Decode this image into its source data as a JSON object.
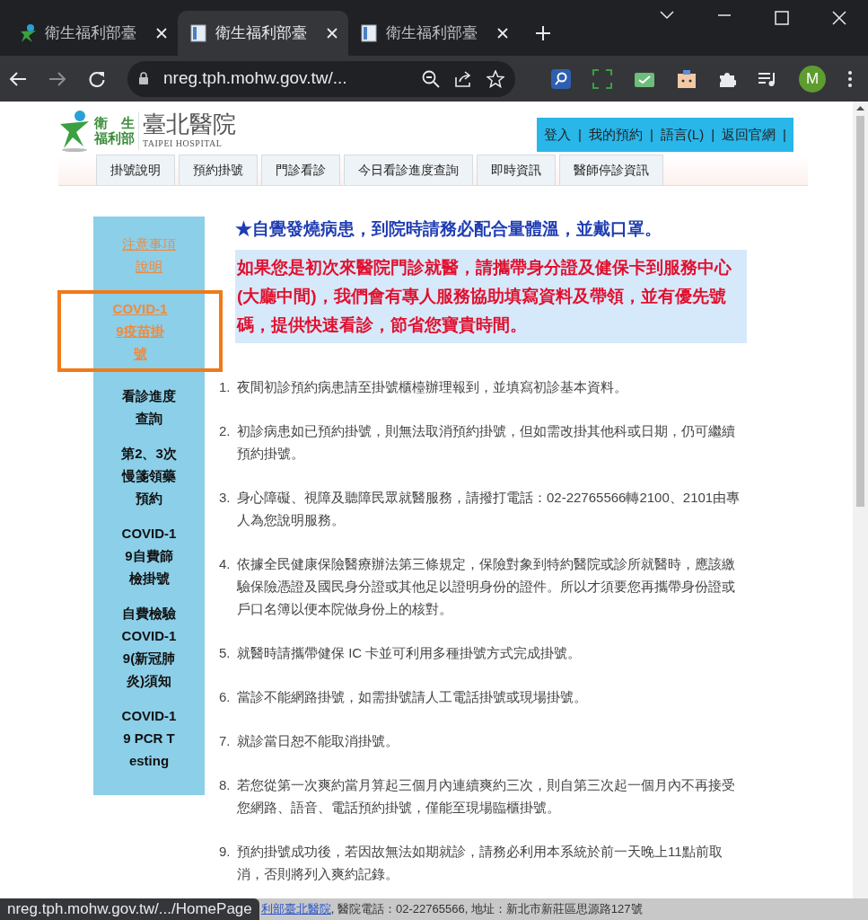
{
  "browser": {
    "tabs": [
      {
        "title": "衛生福利部臺",
        "selected": false,
        "kind": "logo"
      },
      {
        "title": "衛生福利部臺",
        "selected": true,
        "kind": "doc"
      },
      {
        "title": "衛生福利部臺",
        "selected": false,
        "kind": "doc"
      }
    ],
    "address": "nreg.tph.mohw.gov.tw/...",
    "profile": "M"
  },
  "header": {
    "logo": {
      "org_lines": [
        "衛　生",
        "福利部"
      ],
      "title": "臺北醫院",
      "subtitle": "TAIPEI HOSPITAL"
    },
    "top_links": [
      "登入",
      "我的預約",
      "語言(L)",
      "返回官網"
    ],
    "separator": "|",
    "nav_tabs": [
      "掛號說明",
      "預約掛號",
      "門診看診",
      "今日看診進度查詢",
      "即時資訊",
      "醫師停診資訊"
    ]
  },
  "sidebar": [
    {
      "text": "注意事項說明",
      "kind": "link",
      "highlighted": false
    },
    {
      "text": "COVID-19疫苗掛號",
      "kind": "link-bold",
      "highlighted": true
    },
    {
      "text": "看診進度查詢",
      "kind": "bold",
      "highlighted": false
    },
    {
      "text": "第2、3次慢箋領藥預約",
      "kind": "bold",
      "highlighted": false
    },
    {
      "text": "COVID-19自費篩檢掛號",
      "kind": "bold",
      "highlighted": false
    },
    {
      "text": "自費檢驗COVID-19(新冠肺炎)須知",
      "kind": "bold",
      "highlighted": false
    },
    {
      "text": "COVID-19 PCR Testing",
      "kind": "bold",
      "highlighted": false
    }
  ],
  "notice": {
    "headline": "★自覺發燒病患，到院時請務必配合量體溫，並戴口罩。",
    "box": "如果您是初次來醫院門診就醫，請攜帶身分證及健保卡到服務中心(大廳中間)，我們會有專人服務協助填寫資料及帶領，並有優先號碼，提供快速看診，節省您寶貴時間。"
  },
  "rules": [
    {
      "number": "1.",
      "text": "夜間初診預約病患請至掛號櫃檯辦理報到，並填寫初診基本資料。"
    },
    {
      "number": "2.",
      "text": "初診病患如已預約掛號，則無法取消預約掛號，但如需改掛其他科或日期，仍可繼續預約掛號。"
    },
    {
      "number": "3.",
      "text": "身心障礙、視障及聽障民眾就醫服務，請撥打電話：02-22765566轉2100、2101由專人為您說明服務。"
    },
    {
      "number": "4.",
      "text": "依據全民健康保險醫療辦法第三條規定，保險對象到特約醫院或診所就醫時，應該繳驗保險憑證及國民身分證或其他足以證明身份的證件。所以才須要您再攜帶身份證或戶口名簿以便本院做身份上的核對。"
    },
    {
      "number": "5.",
      "text": "就醫時請攜帶健保 IC 卡並可利用多種掛號方式完成掛號。"
    },
    {
      "number": "6.",
      "text": "當診不能網路掛號，如需掛號請人工電話掛號或現場掛號。"
    },
    {
      "number": "7.",
      "text": "就診當日恕不能取消掛號。"
    },
    {
      "number": "8.",
      "text": "若您從第一次爽約當月算起三個月內連續爽約三次，則自第三次起一個月內不再接受您網路、語音、電話預約掛號，僅能至現場臨櫃掛號。"
    },
    {
      "number": "9.",
      "text": "預約掛號成功後，若因故無法如期就診，請務必利用本系統於前一天晚上11點前取消，否則將列入爽約記錄。"
    }
  ],
  "footer": {
    "link": "利部臺北醫院",
    "text": ", 醫院電話：02-22765566, 地址：新北市新莊區思源路127號"
  },
  "status_url": "nreg.tph.mohw.gov.tw/.../HomePage"
}
